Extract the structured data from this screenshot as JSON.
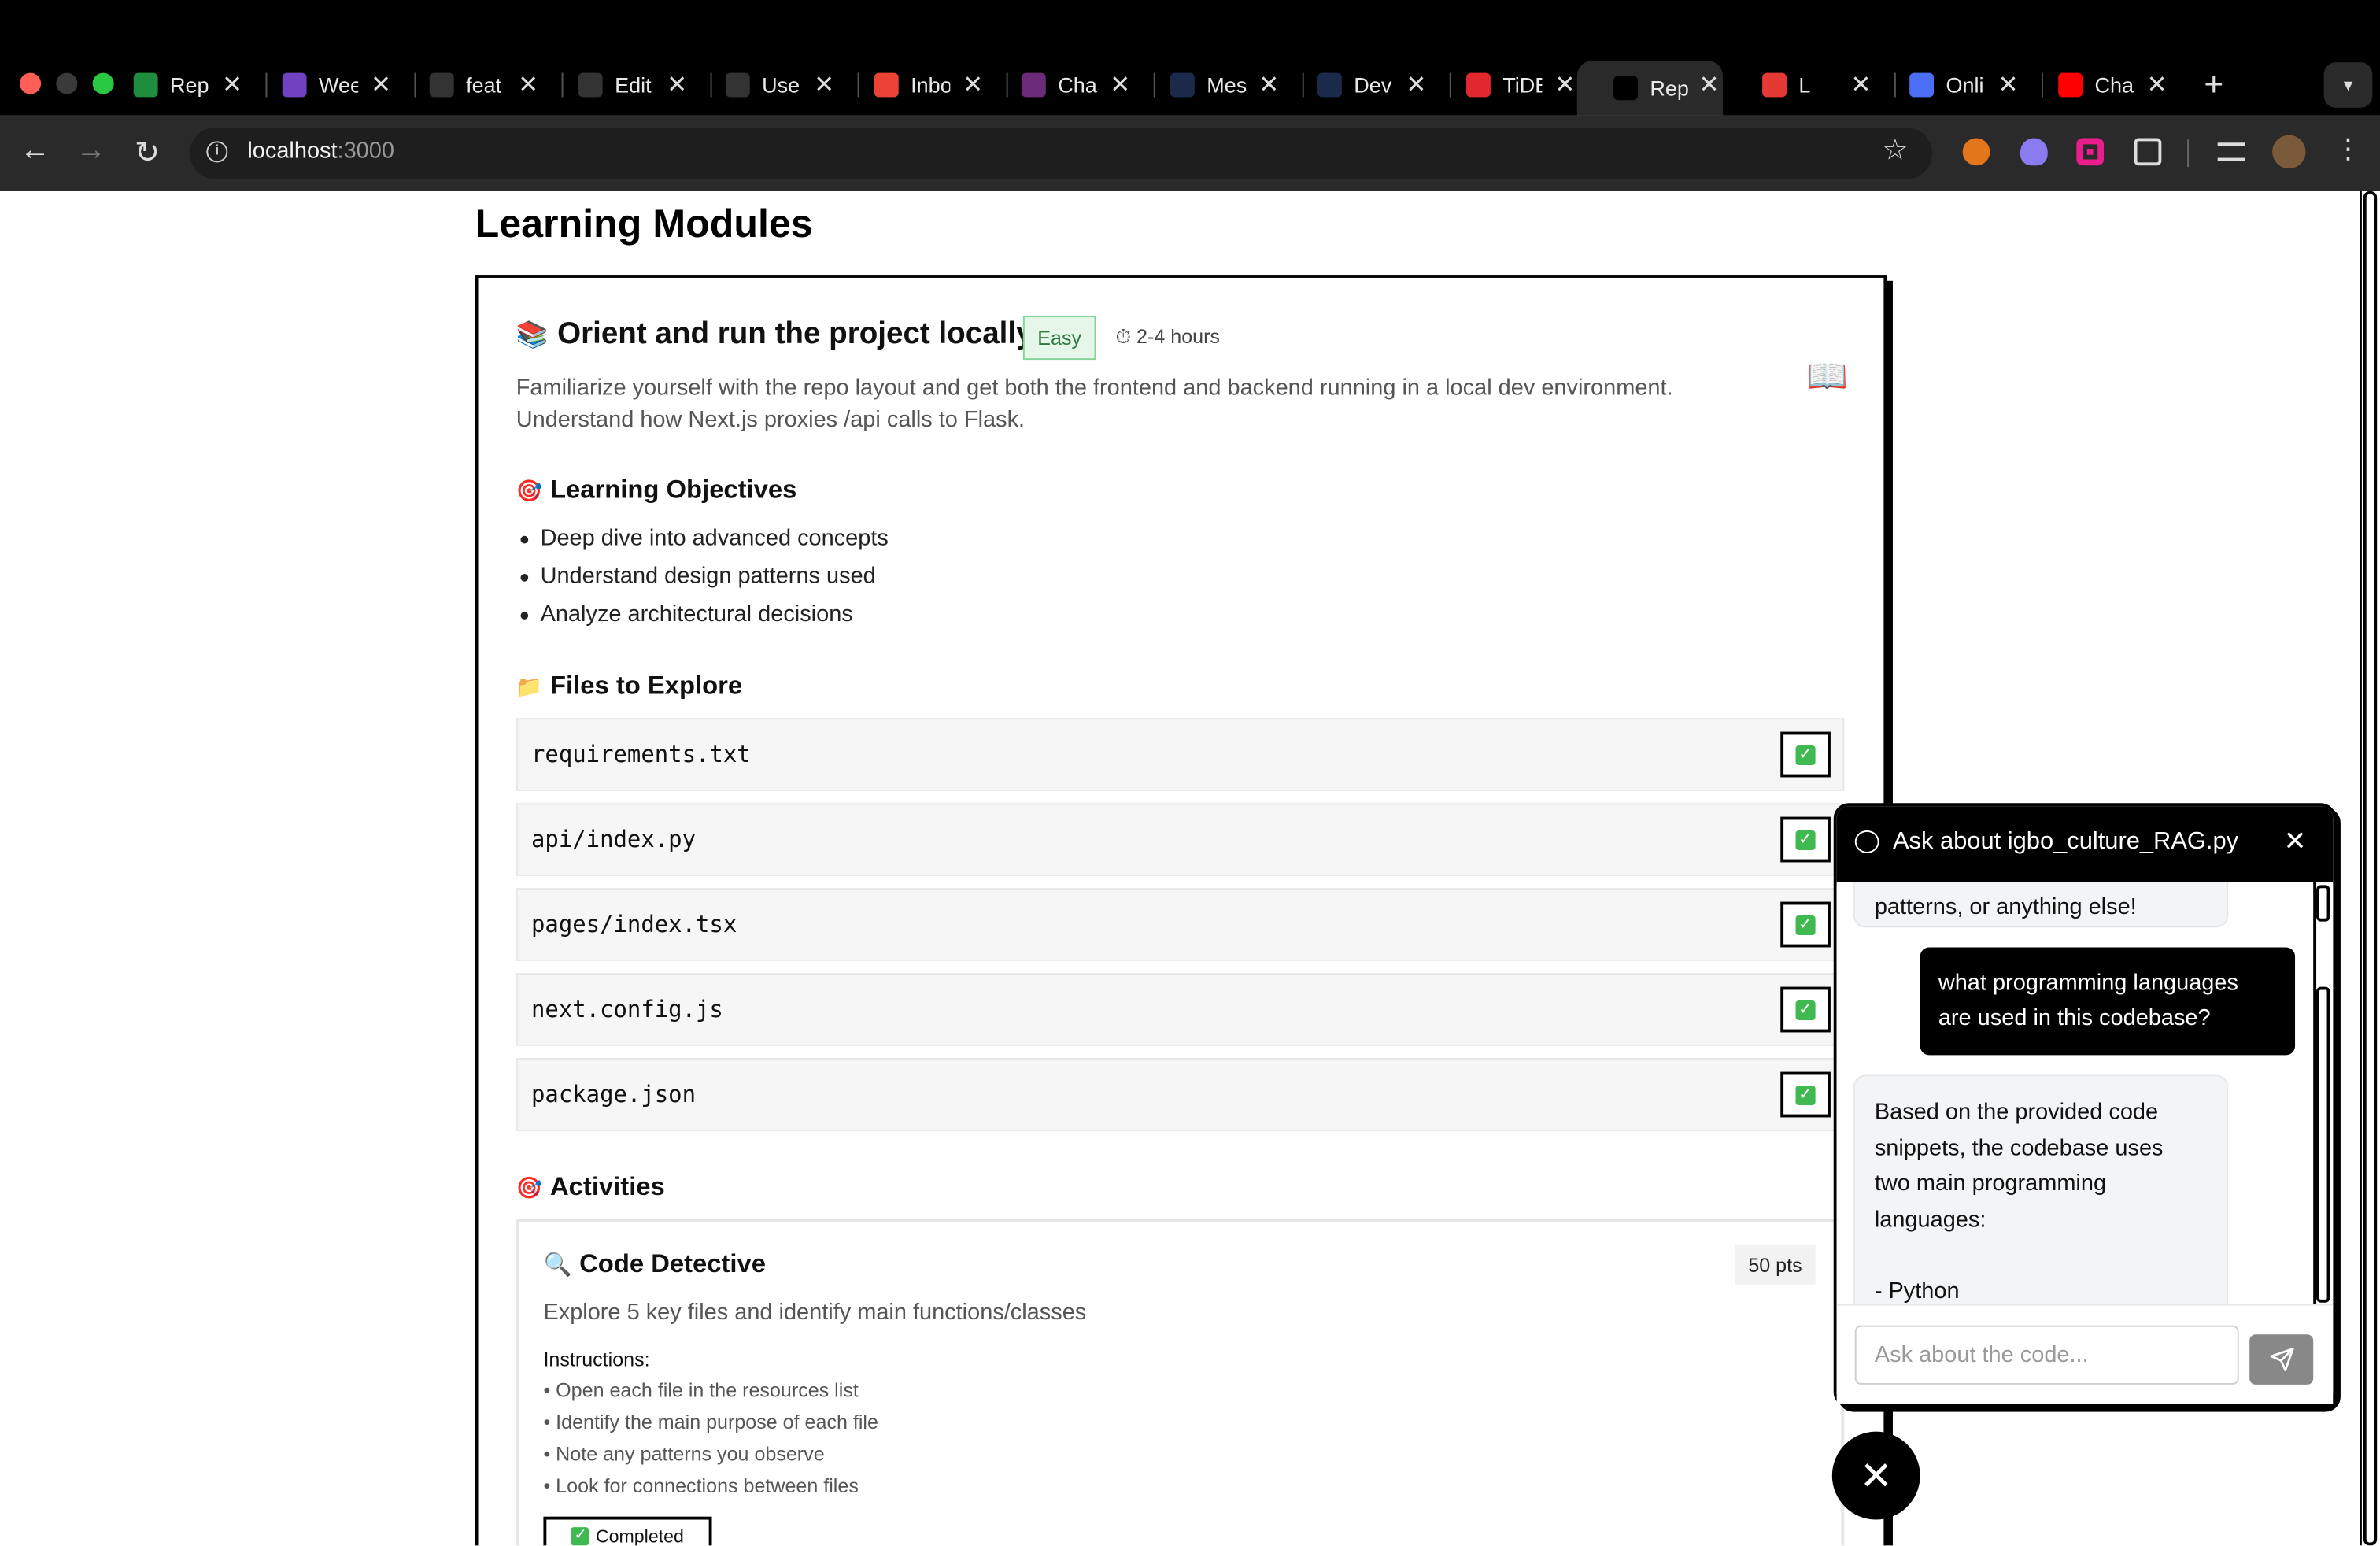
{
  "browser": {
    "tabs": [
      {
        "label": "Rep",
        "icon": "sheets-icon",
        "color": "#1e8e3e"
      },
      {
        "label": "Wee",
        "icon": "list-icon",
        "color": "#6f42c1"
      },
      {
        "label": "feat",
        "icon": "git-icon",
        "color": "#333333"
      },
      {
        "label": "Edit",
        "icon": "github-icon",
        "color": "#333333"
      },
      {
        "label": "Use",
        "icon": "github-icon",
        "color": "#333333"
      },
      {
        "label": "Inbo",
        "icon": "gmail-icon",
        "color": "#ea4335"
      },
      {
        "label": "Cha",
        "icon": "chat-icon",
        "color": "#6b2a7a"
      },
      {
        "label": "Mes",
        "icon": "d-icon",
        "color": "#1b2a4a"
      },
      {
        "label": "Dev",
        "icon": "d-icon",
        "color": "#1b2a4a"
      },
      {
        "label": "TiDE",
        "icon": "tidb-icon",
        "color": "#e0282e"
      },
      {
        "label": "Rep",
        "icon": "triangle-icon",
        "color": "#000000"
      },
      {
        "label": "L",
        "icon": "youtube-music-icon",
        "color": "#e53935"
      },
      {
        "label": "Onli",
        "icon": "globe-icon",
        "color": "#4c6ef5"
      },
      {
        "label": "Cha",
        "icon": "youtube-icon",
        "color": "#ff0000"
      }
    ],
    "url_host": "localhost",
    "url_port": ":3000"
  },
  "page": {
    "title": "Learning Modules",
    "module": {
      "emoji": "📚",
      "title": "Orient and run the project locally",
      "difficulty": "Easy",
      "duration": "⏱ 2-4 hours",
      "book_icon": "📖",
      "description": "Familiarize yourself with the repo layout and get both the frontend and backend running in a local dev environment. Understand how Next.js proxies /api calls to Flask.",
      "objectives_title": "Learning Objectives",
      "objectives_emoji": "🎯",
      "objectives": [
        "Deep dive into advanced concepts",
        "Understand design patterns used",
        "Analyze architectural decisions"
      ],
      "files_title": "Files to Explore",
      "files_emoji": "📁",
      "files": [
        "requirements.txt",
        "api/index.py",
        "pages/index.tsx",
        "next.config.js",
        "package.json"
      ],
      "file_check": "✓",
      "activities_title": "Activities",
      "activities_emoji": "🎯",
      "activity": {
        "emoji": "🔍",
        "title": "Code Detective",
        "points": "50 pts",
        "description": "Explore 5 key files and identify main functions/classes",
        "instructions_label": "Instructions:",
        "instructions": [
          "• Open each file in the resources list",
          "• Identify the main purpose of each file",
          "• Note any patterns you observe",
          "• Look for connections between files"
        ],
        "completed_label": "Completed"
      }
    }
  },
  "chat": {
    "title": "Ask about igbo_culture_RAG.py",
    "messages": [
      {
        "role": "bot",
        "text": "patterns, or anything else!"
      },
      {
        "role": "user",
        "line1": "what programming languages",
        "line2": "are used in this codebase?"
      },
      {
        "role": "bot",
        "lines": [
          "Based on the provided code",
          "snippets, the codebase uses",
          "two main programming",
          "languages:",
          "",
          "- Python"
        ]
      }
    ],
    "input_placeholder": "Ask about the code..."
  },
  "colors": {
    "accent": "#000000",
    "easy_badge_bg": "#e6f7ea",
    "check_green": "#3fb950"
  }
}
